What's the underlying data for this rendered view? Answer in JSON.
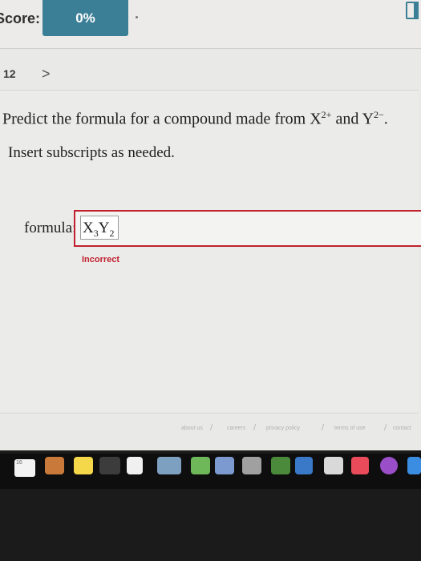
{
  "header": {
    "score_label": "Score:",
    "score_value": "0%"
  },
  "question": {
    "number": "12",
    "next_arrow": ">",
    "prompt_lead": "Predict the formula for a compound made from X",
    "cation_charge": "2+",
    "prompt_mid": " and Y",
    "anion_charge": "2−",
    "prompt_end": ".",
    "instruction": "Insert subscripts as needed."
  },
  "answer": {
    "label": "formula:",
    "x": "X",
    "x_sub": "3",
    "y": "Y",
    "y_sub": "2",
    "status": "Incorrect"
  },
  "footer": {
    "links": [
      "about us",
      "careers",
      "privacy policy",
      "terms of use",
      "contact"
    ]
  },
  "dock": {
    "calendar_day": "16",
    "icons": [
      "calendar-icon",
      "folder-icon",
      "notes-icon",
      "terminal-icon",
      "document-icon",
      "photos-icon",
      "maps-icon",
      "chart-icon",
      "keynote-icon",
      "news-icon",
      "music-icon",
      "podcasts-icon",
      "app-store-icon"
    ]
  },
  "colors": {
    "accent": "#3b7f96",
    "error": "#c0212e"
  }
}
